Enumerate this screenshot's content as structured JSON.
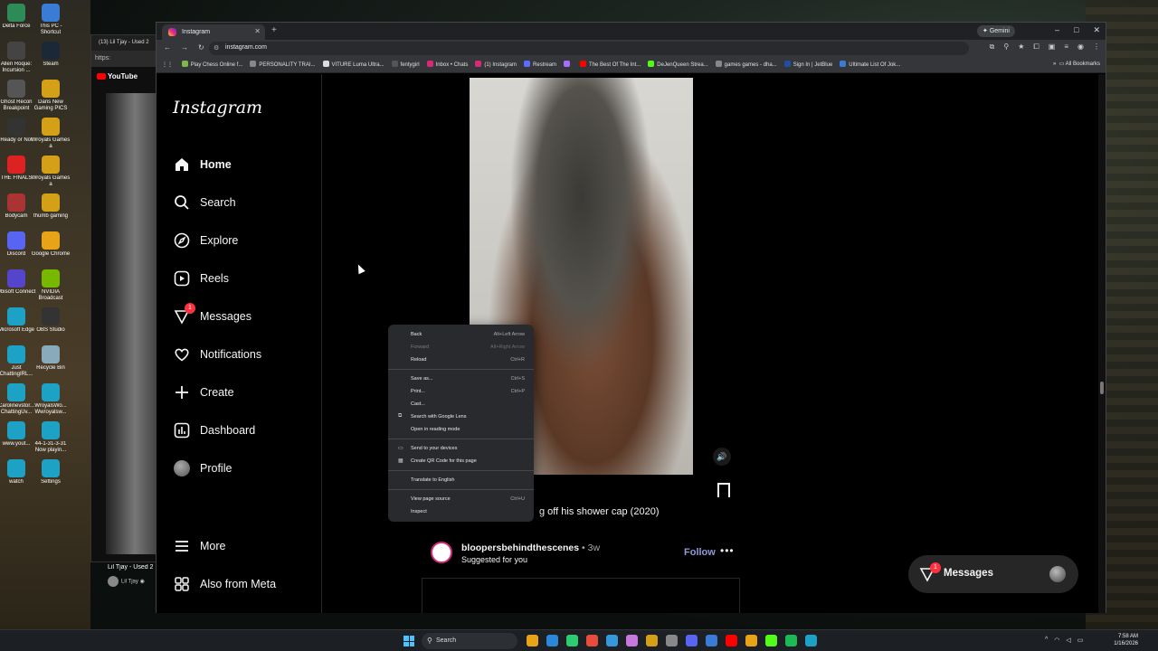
{
  "desktop": {
    "icons": [
      {
        "label": "Delta Force",
        "color": "#2e8b57"
      },
      {
        "label": "This PC - Shortcut",
        "color": "#3a7bd5"
      },
      {
        "label": "Allen Roque: Incursion ...",
        "color": "#444"
      },
      {
        "label": "Steam",
        "color": "#1b2838"
      },
      {
        "label": "Ghost Recon Breakpoint",
        "color": "#555"
      },
      {
        "label": "Dans New Gaming PICS",
        "color": "#d4a017"
      },
      {
        "label": "Ready or Not",
        "color": "#333"
      },
      {
        "label": "Wroyals Games a",
        "color": "#d4a017"
      },
      {
        "label": "THE FINALS",
        "color": "#d22"
      },
      {
        "label": "Wroyals Games a",
        "color": "#d4a017"
      },
      {
        "label": "Bodycam",
        "color": "#a33"
      },
      {
        "label": "thumb gaming",
        "color": "#d4a017"
      },
      {
        "label": "Discord",
        "color": "#5865f2"
      },
      {
        "label": "Google Chrome",
        "color": "#e8a317"
      },
      {
        "label": "Ubisoft Connect",
        "color": "#5544cc"
      },
      {
        "label": "NVIDIA Broadcast",
        "color": "#76b900"
      },
      {
        "label": "Microsoft Edge",
        "color": "#1da1c5"
      },
      {
        "label": "OBS Studio",
        "color": "#333"
      },
      {
        "label": "Just ChattingIRL...",
        "color": "#1da1c5"
      },
      {
        "label": "Recycle Bin",
        "color": "#8ab"
      },
      {
        "label": "Carolinevstor... ChattingUv...",
        "color": "#1da1c5"
      },
      {
        "label": "WroyalsWo... Wwroyalsw...",
        "color": "#1da1c5"
      },
      {
        "label": "www.yout...",
        "color": "#1da1c5"
      },
      {
        "label": "44-1-31-3-31 Now playin...",
        "color": "#1da1c5"
      },
      {
        "label": "watch",
        "color": "#1da1c5"
      },
      {
        "label": "Settings",
        "color": "#1da1c5"
      }
    ]
  },
  "youtube_window": {
    "tab_title": "(13) Lil Tjay - Used 2",
    "address": "https:",
    "logo_text": "YouTube",
    "video_title": "Lil Tjay - Used 2",
    "channel": "Lil Tjay ◉"
  },
  "browser": {
    "tab_title": "Instagram",
    "new_tab": "+",
    "gemini_label": "Gemini",
    "address": "instagram.com",
    "window_controls": [
      "–",
      "□",
      "✕"
    ],
    "bookmarks": [
      {
        "label": "Play Chess Online f...",
        "color": "#81b64c"
      },
      {
        "label": "PERSONALITY TRAI...",
        "color": "#888"
      },
      {
        "label": "VITURE Luma Ultra...",
        "color": "#ddd"
      },
      {
        "label": "fentygirl",
        "color": "#555"
      },
      {
        "label": "Inbox • Chats",
        "color": "#d62976"
      },
      {
        "label": "(1) Instagram",
        "color": "#d62976"
      },
      {
        "label": "Restream",
        "color": "#5b6cff"
      },
      {
        "label": "",
        "color": "#a66cff"
      },
      {
        "label": "The Best Of The Int...",
        "color": "#f00"
      },
      {
        "label": "DeJenQueen Strea...",
        "color": "#53fc18"
      },
      {
        "label": "games games - dha...",
        "color": "#888"
      },
      {
        "label": "Sign In | JetBlue",
        "color": "#1e4fa3"
      },
      {
        "label": "Ultimate List Of Jok...",
        "color": "#3a7bd5"
      }
    ],
    "all_bookmarks": "All Bookmarks"
  },
  "instagram": {
    "logo": "Instagram",
    "nav": [
      {
        "label": "Home",
        "icon": "home-icon",
        "active": true
      },
      {
        "label": "Search",
        "icon": "search-icon"
      },
      {
        "label": "Explore",
        "icon": "compass-icon"
      },
      {
        "label": "Reels",
        "icon": "reels-icon"
      },
      {
        "label": "Messages",
        "icon": "messenger-icon",
        "badge": "1"
      },
      {
        "label": "Notifications",
        "icon": "heart-icon"
      },
      {
        "label": "Create",
        "icon": "plus-icon"
      },
      {
        "label": "Dashboard",
        "icon": "dashboard-icon"
      },
      {
        "label": "Profile",
        "icon": "avatar-icon"
      }
    ],
    "more": "More",
    "also_from_meta": "Also from Meta",
    "post_caption": "g off his shower cap (2020)",
    "suggested": {
      "username": "bloopersbehindthescenes",
      "time": "• 3w",
      "subtitle": "Suggested for you",
      "follow": "Follow",
      "more": "•••"
    },
    "floating_messages": {
      "label": "Messages",
      "badge": "1"
    }
  },
  "context_menu": {
    "groups": [
      [
        {
          "label": "Back",
          "shortcut": "Alt+Left Arrow"
        },
        {
          "label": "Forward",
          "shortcut": "Alt+Right Arrow",
          "disabled": true
        },
        {
          "label": "Reload",
          "shortcut": "Ctrl+R"
        }
      ],
      [
        {
          "label": "Save as...",
          "shortcut": "Ctrl+S"
        },
        {
          "label": "Print...",
          "shortcut": "Ctrl+P"
        },
        {
          "label": "Cast...",
          "shortcut": ""
        },
        {
          "label": "Search with Google Lens",
          "shortcut": "",
          "icon": "⧉"
        },
        {
          "label": "Open in reading mode",
          "shortcut": ""
        }
      ],
      [
        {
          "label": "Send to your devices",
          "shortcut": "",
          "icon": "▭"
        },
        {
          "label": "Create QR Code for this page",
          "shortcut": "",
          "icon": "▦"
        }
      ],
      [
        {
          "label": "Translate to English",
          "shortcut": ""
        }
      ],
      [
        {
          "label": "View page source",
          "shortcut": "Ctrl+U"
        },
        {
          "label": "Inspect",
          "shortcut": ""
        }
      ]
    ]
  },
  "taskbar": {
    "search_placeholder": "Search",
    "apps": [
      "#e8a317",
      "#2b88d8",
      "#2ecc71",
      "#e74c3c",
      "#3498db",
      "#c678dd",
      "#d4a017",
      "#888",
      "#5865f2",
      "#3a7bd5",
      "#f00",
      "#e8a317",
      "#53fc18",
      "#1db954",
      "#1da1c5"
    ],
    "time": "7:58 AM",
    "date": "1/16/2026"
  }
}
